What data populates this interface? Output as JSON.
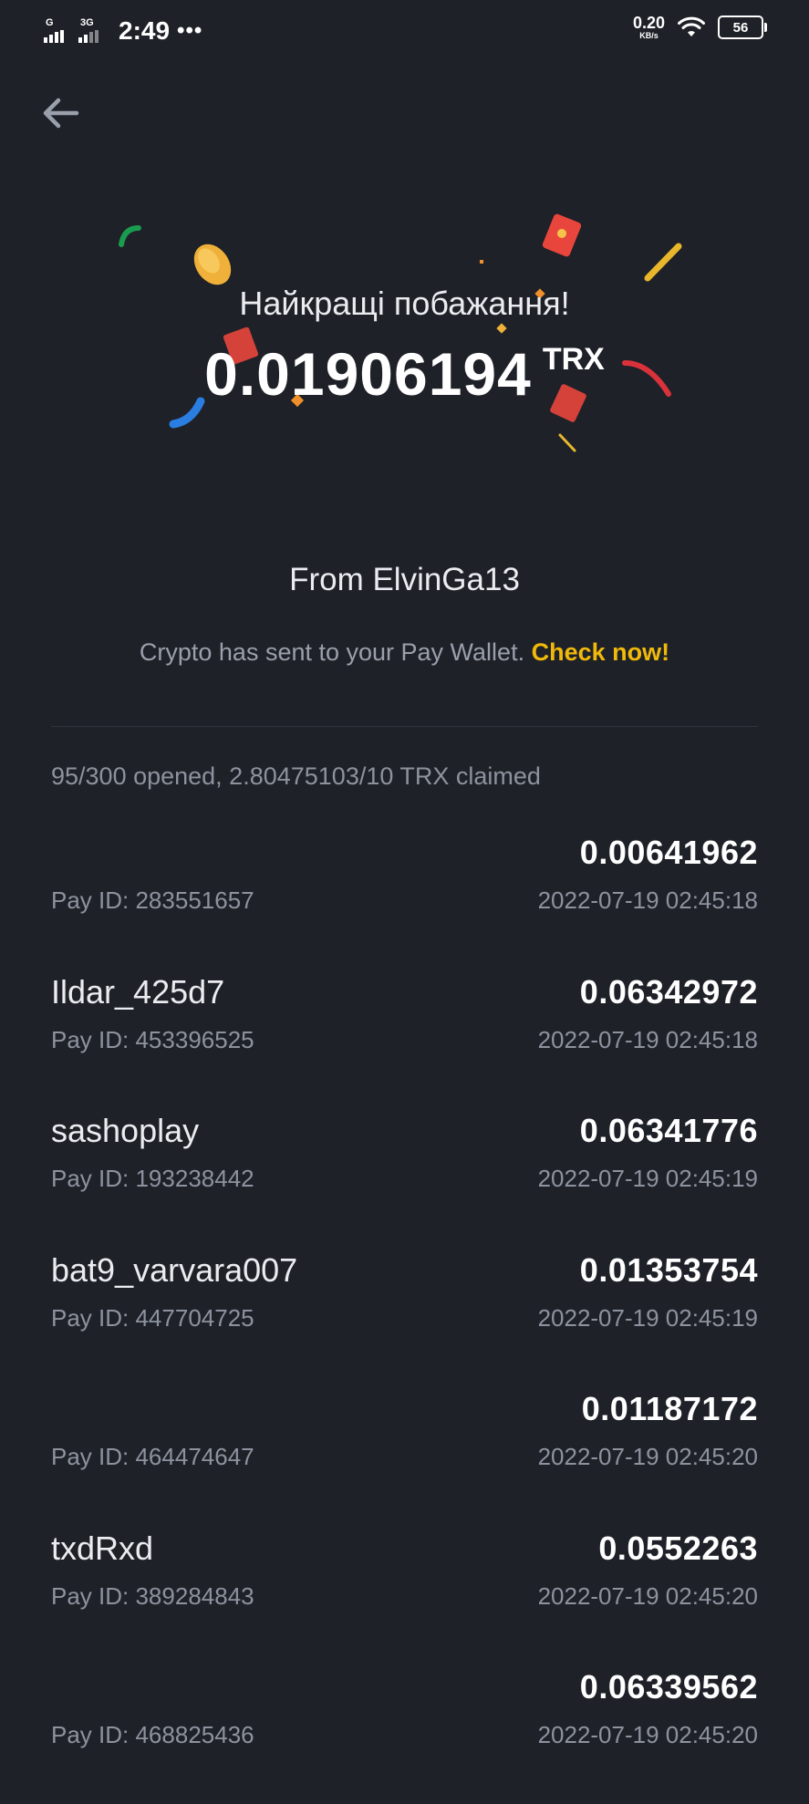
{
  "status_bar": {
    "net_1": "G",
    "net_2": "3G",
    "time": "2:49",
    "dots": "•••",
    "speed_value": "0.20",
    "speed_unit": "KB/s",
    "battery": "56"
  },
  "header": {
    "back_icon": "arrow-left-icon"
  },
  "hero": {
    "greeting": "Найкращі побажання!",
    "amount": "0.01906194",
    "unit": "TRX",
    "from": "From ElvinGa13",
    "sent_text": "Crypto has sent to your Pay Wallet. ",
    "check_now": "Check now!"
  },
  "summary": "95/300 opened, 2.80475103/10 TRX claimed",
  "colors": {
    "background": "#1e2128",
    "accent": "#f0b90b",
    "secondary_text": "#8d939e"
  },
  "claims": [
    {
      "name": "",
      "amount": "0.00641962",
      "pay_id": "Pay ID: 283551657",
      "time": "2022-07-19 02:45:18"
    },
    {
      "name": "Ildar_425d7",
      "amount": "0.06342972",
      "pay_id": "Pay ID: 453396525",
      "time": "2022-07-19 02:45:18"
    },
    {
      "name": "sashoplay",
      "amount": "0.06341776",
      "pay_id": "Pay ID: 193238442",
      "time": "2022-07-19 02:45:19"
    },
    {
      "name": "bat9_varvara007",
      "amount": "0.01353754",
      "pay_id": "Pay ID: 447704725",
      "time": "2022-07-19 02:45:19"
    },
    {
      "name": "",
      "amount": "0.01187172",
      "pay_id": "Pay ID: 464474647",
      "time": "2022-07-19 02:45:20"
    },
    {
      "name": "txdRxd",
      "amount": "0.0552263",
      "pay_id": "Pay ID: 389284843",
      "time": "2022-07-19 02:45:20"
    },
    {
      "name": "",
      "amount": "0.06339562",
      "pay_id": "Pay ID: 468825436",
      "time": "2022-07-19 02:45:20"
    }
  ]
}
